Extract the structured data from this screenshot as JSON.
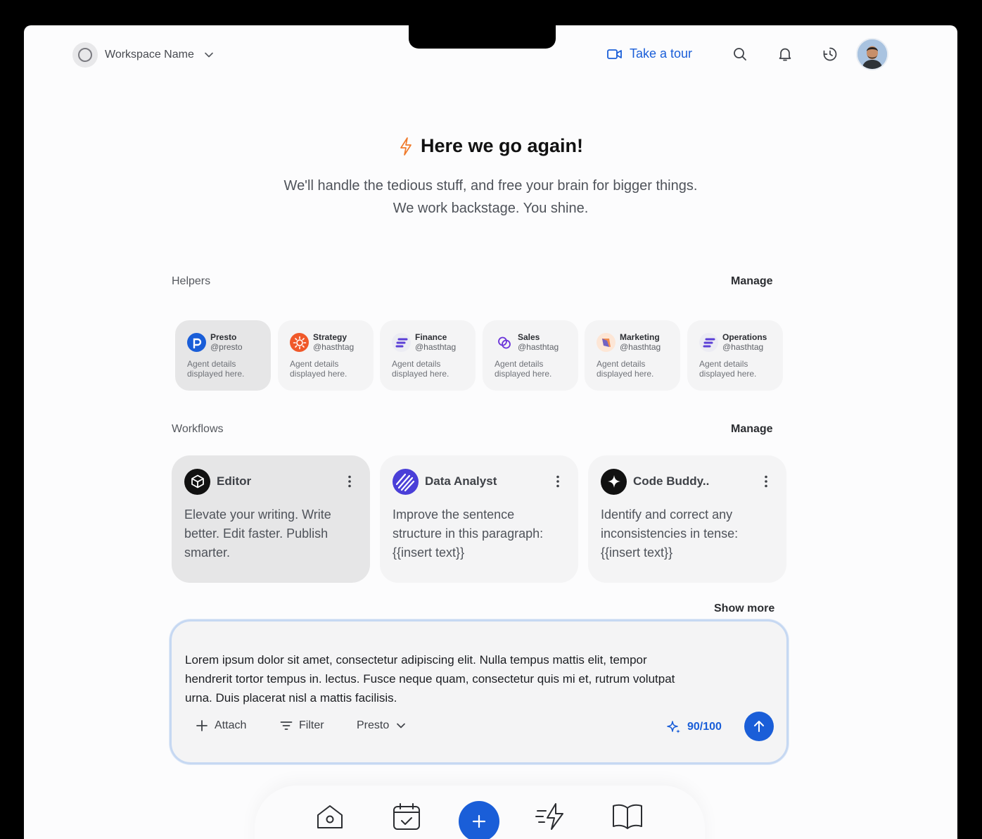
{
  "topbar": {
    "workspace_name": "Workspace Name",
    "tour_label": "Take a tour",
    "icons": [
      "video-camera-icon",
      "search-icon",
      "bell-icon",
      "history-icon"
    ]
  },
  "hero": {
    "title": "Here we go again!",
    "subtitle_line1": "We'll handle the tedious stuff, and free your brain for bigger things.",
    "subtitle_line2": "We work backstage. You shine."
  },
  "helpers": {
    "label": "Helpers",
    "manage": "Manage",
    "items": [
      {
        "name": "Presto",
        "handle": "@presto",
        "desc": "Agent details displayed here."
      },
      {
        "name": "Strategy",
        "handle": "@hasthtag",
        "desc": "Agent details displayed here."
      },
      {
        "name": "Finance",
        "handle": "@hasthtag",
        "desc": "Agent details displayed here."
      },
      {
        "name": "Sales",
        "handle": "@hasthtag",
        "desc": "Agent details displayed here."
      },
      {
        "name": "Marketing",
        "handle": "@hasthtag",
        "desc": "Agent details displayed here."
      },
      {
        "name": "Operations",
        "handle": "@hasthtag",
        "desc": "Agent details displayed here."
      }
    ]
  },
  "workflows": {
    "label": "Workflows",
    "manage": "Manage",
    "items": [
      {
        "name": "Editor",
        "desc": "Elevate your writing. Write better. Edit faster. Publish smarter."
      },
      {
        "name": "Data Analyst",
        "desc": "Improve the sentence structure in this paragraph: {{insert text}}"
      },
      {
        "name": "Code Buddy..",
        "desc": "Identify and correct any inconsistencies in tense: {{insert text}}"
      }
    ],
    "show_more": "Show more"
  },
  "composer": {
    "text": "Lorem ipsum dolor sit amet, consectetur adipiscing elit. Nulla tempus mattis elit, tempor hendrerit tortor tempus in.  lectus. Fusce neque quam, consectetur quis mi et, rutrum volutpat urna. Duis placerat nisl a mattis facilisis.",
    "attach_label": "Attach",
    "filter_label": "Filter",
    "model_label": "Presto",
    "credits": "90/100"
  },
  "dock": {
    "items": [
      "home-icon",
      "calendar-icon",
      "add-icon",
      "lightning-icon",
      "book-icon"
    ]
  },
  "colors": {
    "accent": "#1a5ed8",
    "hero_icon": "#f07a2b"
  }
}
